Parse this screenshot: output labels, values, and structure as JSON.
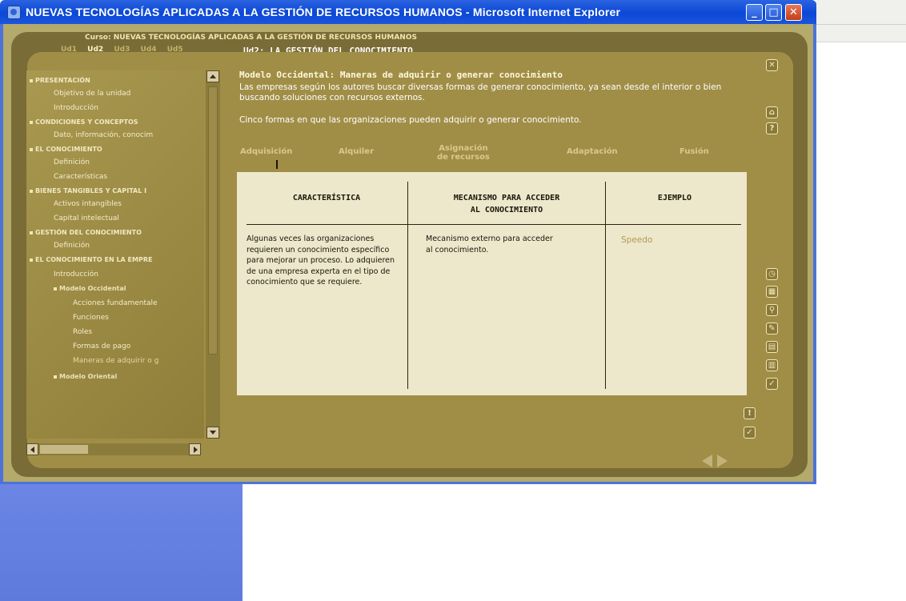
{
  "window": {
    "title": "NUEVAS TECNOLOGÍAS APLICADAS A LA GESTIÓN DE RECURSOS HUMANOS - Microsoft Internet Explorer"
  },
  "header": {
    "course": "Curso: NUEVAS TECNOLOGÍAS APLICADAS A LA GESTIÓN DE RECURSOS HUMANOS",
    "units": [
      "Ud1",
      "Ud2",
      "Ud3",
      "Ud4",
      "Ud5"
    ],
    "current_unit": "Ud2",
    "unit_title": "Ud2: LA GESTIÓN DEL CONOCIMIENTO"
  },
  "toc": {
    "items": [
      {
        "label": "PRESENTACIÓN",
        "kind": "section"
      },
      {
        "label": "Objetivo de la unidad",
        "kind": "item"
      },
      {
        "label": "Introducción",
        "kind": "item"
      },
      {
        "label": "CONDICIONES Y CONCEPTOS",
        "kind": "section"
      },
      {
        "label": "Dato, información, conocim",
        "kind": "item"
      },
      {
        "label": "EL CONOCIMIENTO",
        "kind": "section"
      },
      {
        "label": "Definición",
        "kind": "item"
      },
      {
        "label": "Características",
        "kind": "item"
      },
      {
        "label": "BIENES TANGIBLES Y CAPITAL I",
        "kind": "section"
      },
      {
        "label": "Activos intangibles",
        "kind": "item"
      },
      {
        "label": "Capital intelectual",
        "kind": "item"
      },
      {
        "label": "GESTIÓN DEL CONOCIMIENTO",
        "kind": "section"
      },
      {
        "label": "Definición",
        "kind": "item"
      },
      {
        "label": "EL CONOCIMIENTO EN LA EMPRE",
        "kind": "section"
      },
      {
        "label": "Introducción",
        "kind": "item"
      },
      {
        "label": "Modelo Occidental",
        "kind": "subsection"
      },
      {
        "label": "Acciones fundamentale",
        "kind": "subitem"
      },
      {
        "label": "Funciones",
        "kind": "subitem"
      },
      {
        "label": "Roles",
        "kind": "subitem"
      },
      {
        "label": "Formas de pago",
        "kind": "subitem"
      },
      {
        "label": "Maneras de adquirir o g",
        "kind": "subitem"
      },
      {
        "label": "Modelo Oriental",
        "kind": "subsection"
      }
    ]
  },
  "content": {
    "title": "Modelo Occidental: Maneras de adquirir o generar conocimiento",
    "intro": "Las empresas según los autores buscar diversas formas de generar conocimiento, ya sean desde el interior o bien buscando soluciones con recursos externos.",
    "intro2": "Cinco formas en que las organizaciones pueden adquirir o generar conocimiento.",
    "tabs": [
      {
        "label": "Adquisición"
      },
      {
        "label": "Alquiler"
      },
      {
        "label": "Asignación de recursos",
        "line1": "Asignación",
        "line2": "de recursos"
      },
      {
        "label": "Adaptación"
      },
      {
        "label": "Fusión"
      }
    ],
    "active_tab": "Adquisición",
    "table": {
      "headers": [
        "CARACTERÍSTICA",
        "MECANISMO PARA ACCEDER AL CONOCIMIENTO",
        "EJEMPLO"
      ],
      "header2_line1": "MECANISMO PARA ACCEDER",
      "header2_line2": "AL CONOCIMIENTO",
      "row": {
        "caracteristica": "Algunas veces las organizaciones requieren un conocimiento específico para mejorar un proceso. Lo adquieren de una empresa experta en el tipo de conocimiento que se requiere.",
        "mecanismo": "Mecanismo externo para acceder al conocimiento.",
        "ejemplo": "Speedo"
      }
    }
  },
  "icons": {
    "top": [
      "close-icon",
      "home-icon",
      "help-icon"
    ],
    "tools": [
      "clock-icon",
      "calculator-icon",
      "search-icon",
      "notes-icon",
      "glossary-icon",
      "bibliography-icon",
      "check-icon"
    ],
    "bottom": [
      "alert-icon",
      "confirm-icon"
    ],
    "nav": [
      "prev-arrow-icon",
      "next-arrow-icon"
    ]
  },
  "colors": {
    "frame": "#7a6c36",
    "panel": "#ede7cc",
    "accent": "#b29a52",
    "titlebar": "#0a48d6"
  }
}
